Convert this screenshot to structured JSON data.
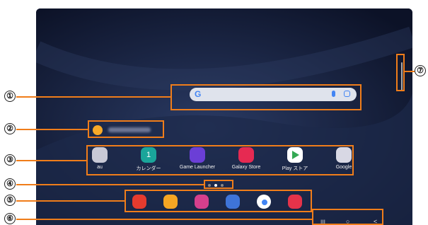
{
  "callouts": [
    "①",
    "②",
    "③",
    "④",
    "⑤",
    "⑥",
    "⑦"
  ],
  "search": {
    "logo": "G"
  },
  "apps": [
    {
      "label": "au",
      "icon": "folder-icon"
    },
    {
      "label": "カレンダー",
      "icon": "calendar-icon",
      "glyph": "1"
    },
    {
      "label": "Game Launcher",
      "icon": "game-launcher-icon"
    },
    {
      "label": "Galaxy Store",
      "icon": "galaxy-store-icon"
    },
    {
      "label": "Play ストア",
      "icon": "play-store-icon"
    },
    {
      "label": "Google",
      "icon": "google-folder-icon"
    }
  ],
  "dock": [
    {
      "icon": "notes-icon",
      "color": "#e53b2e"
    },
    {
      "icon": "my-files-icon",
      "color": "#f5a623"
    },
    {
      "icon": "gallery-icon",
      "color": "#d63f8c"
    },
    {
      "icon": "messages-icon",
      "color": "#3e74d8"
    },
    {
      "icon": "chrome-icon",
      "color": "#ffffff"
    },
    {
      "icon": "camera-icon",
      "color": "#e5334a"
    }
  ],
  "nav": {
    "recent": "|||",
    "home": "○",
    "back": "<"
  },
  "colors": {
    "accent": "#f07d1a",
    "wallpaper": "#111a33"
  }
}
